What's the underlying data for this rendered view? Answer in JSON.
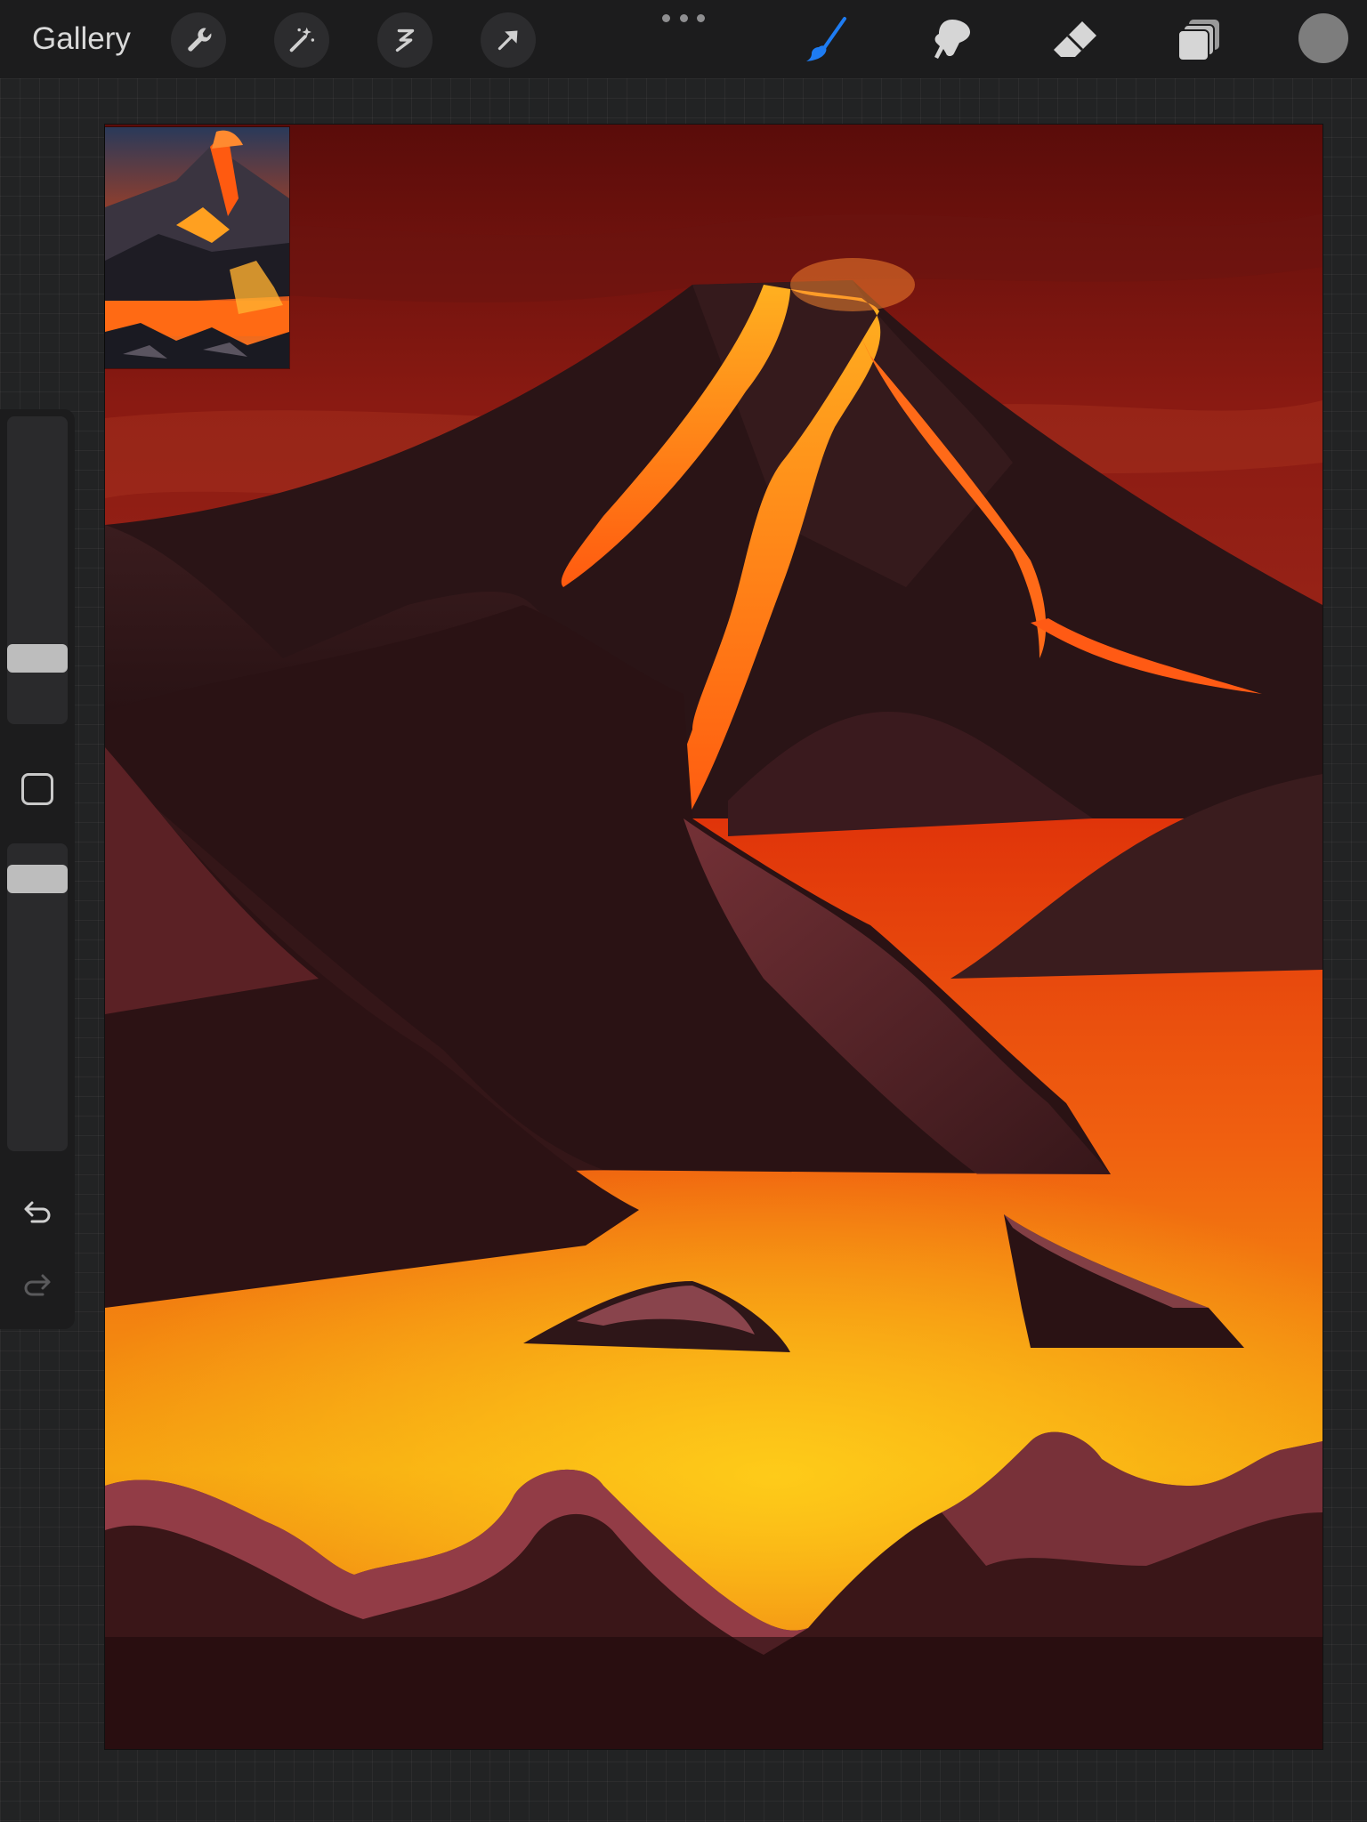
{
  "toolbar": {
    "gallery_label": "Gallery",
    "left_tools": [
      "wrench-icon",
      "magic-wand-icon",
      "selection-icon",
      "transform-arrow-icon"
    ],
    "right_tools": [
      "brush-icon",
      "smudge-icon",
      "eraser-icon",
      "layers-icon"
    ],
    "active_tool": "brush",
    "current_color": "#7d7d7d",
    "accent_color": "#1e7cf2"
  },
  "sidebar": {
    "brush_size_level": 0.2,
    "opacity_level": 0.8,
    "undo_icon": "undo-icon",
    "redo_icon": "redo-icon"
  },
  "canvas": {
    "content": "volcano-artwork",
    "reference_thumbnail": "volcano-reference-image"
  }
}
